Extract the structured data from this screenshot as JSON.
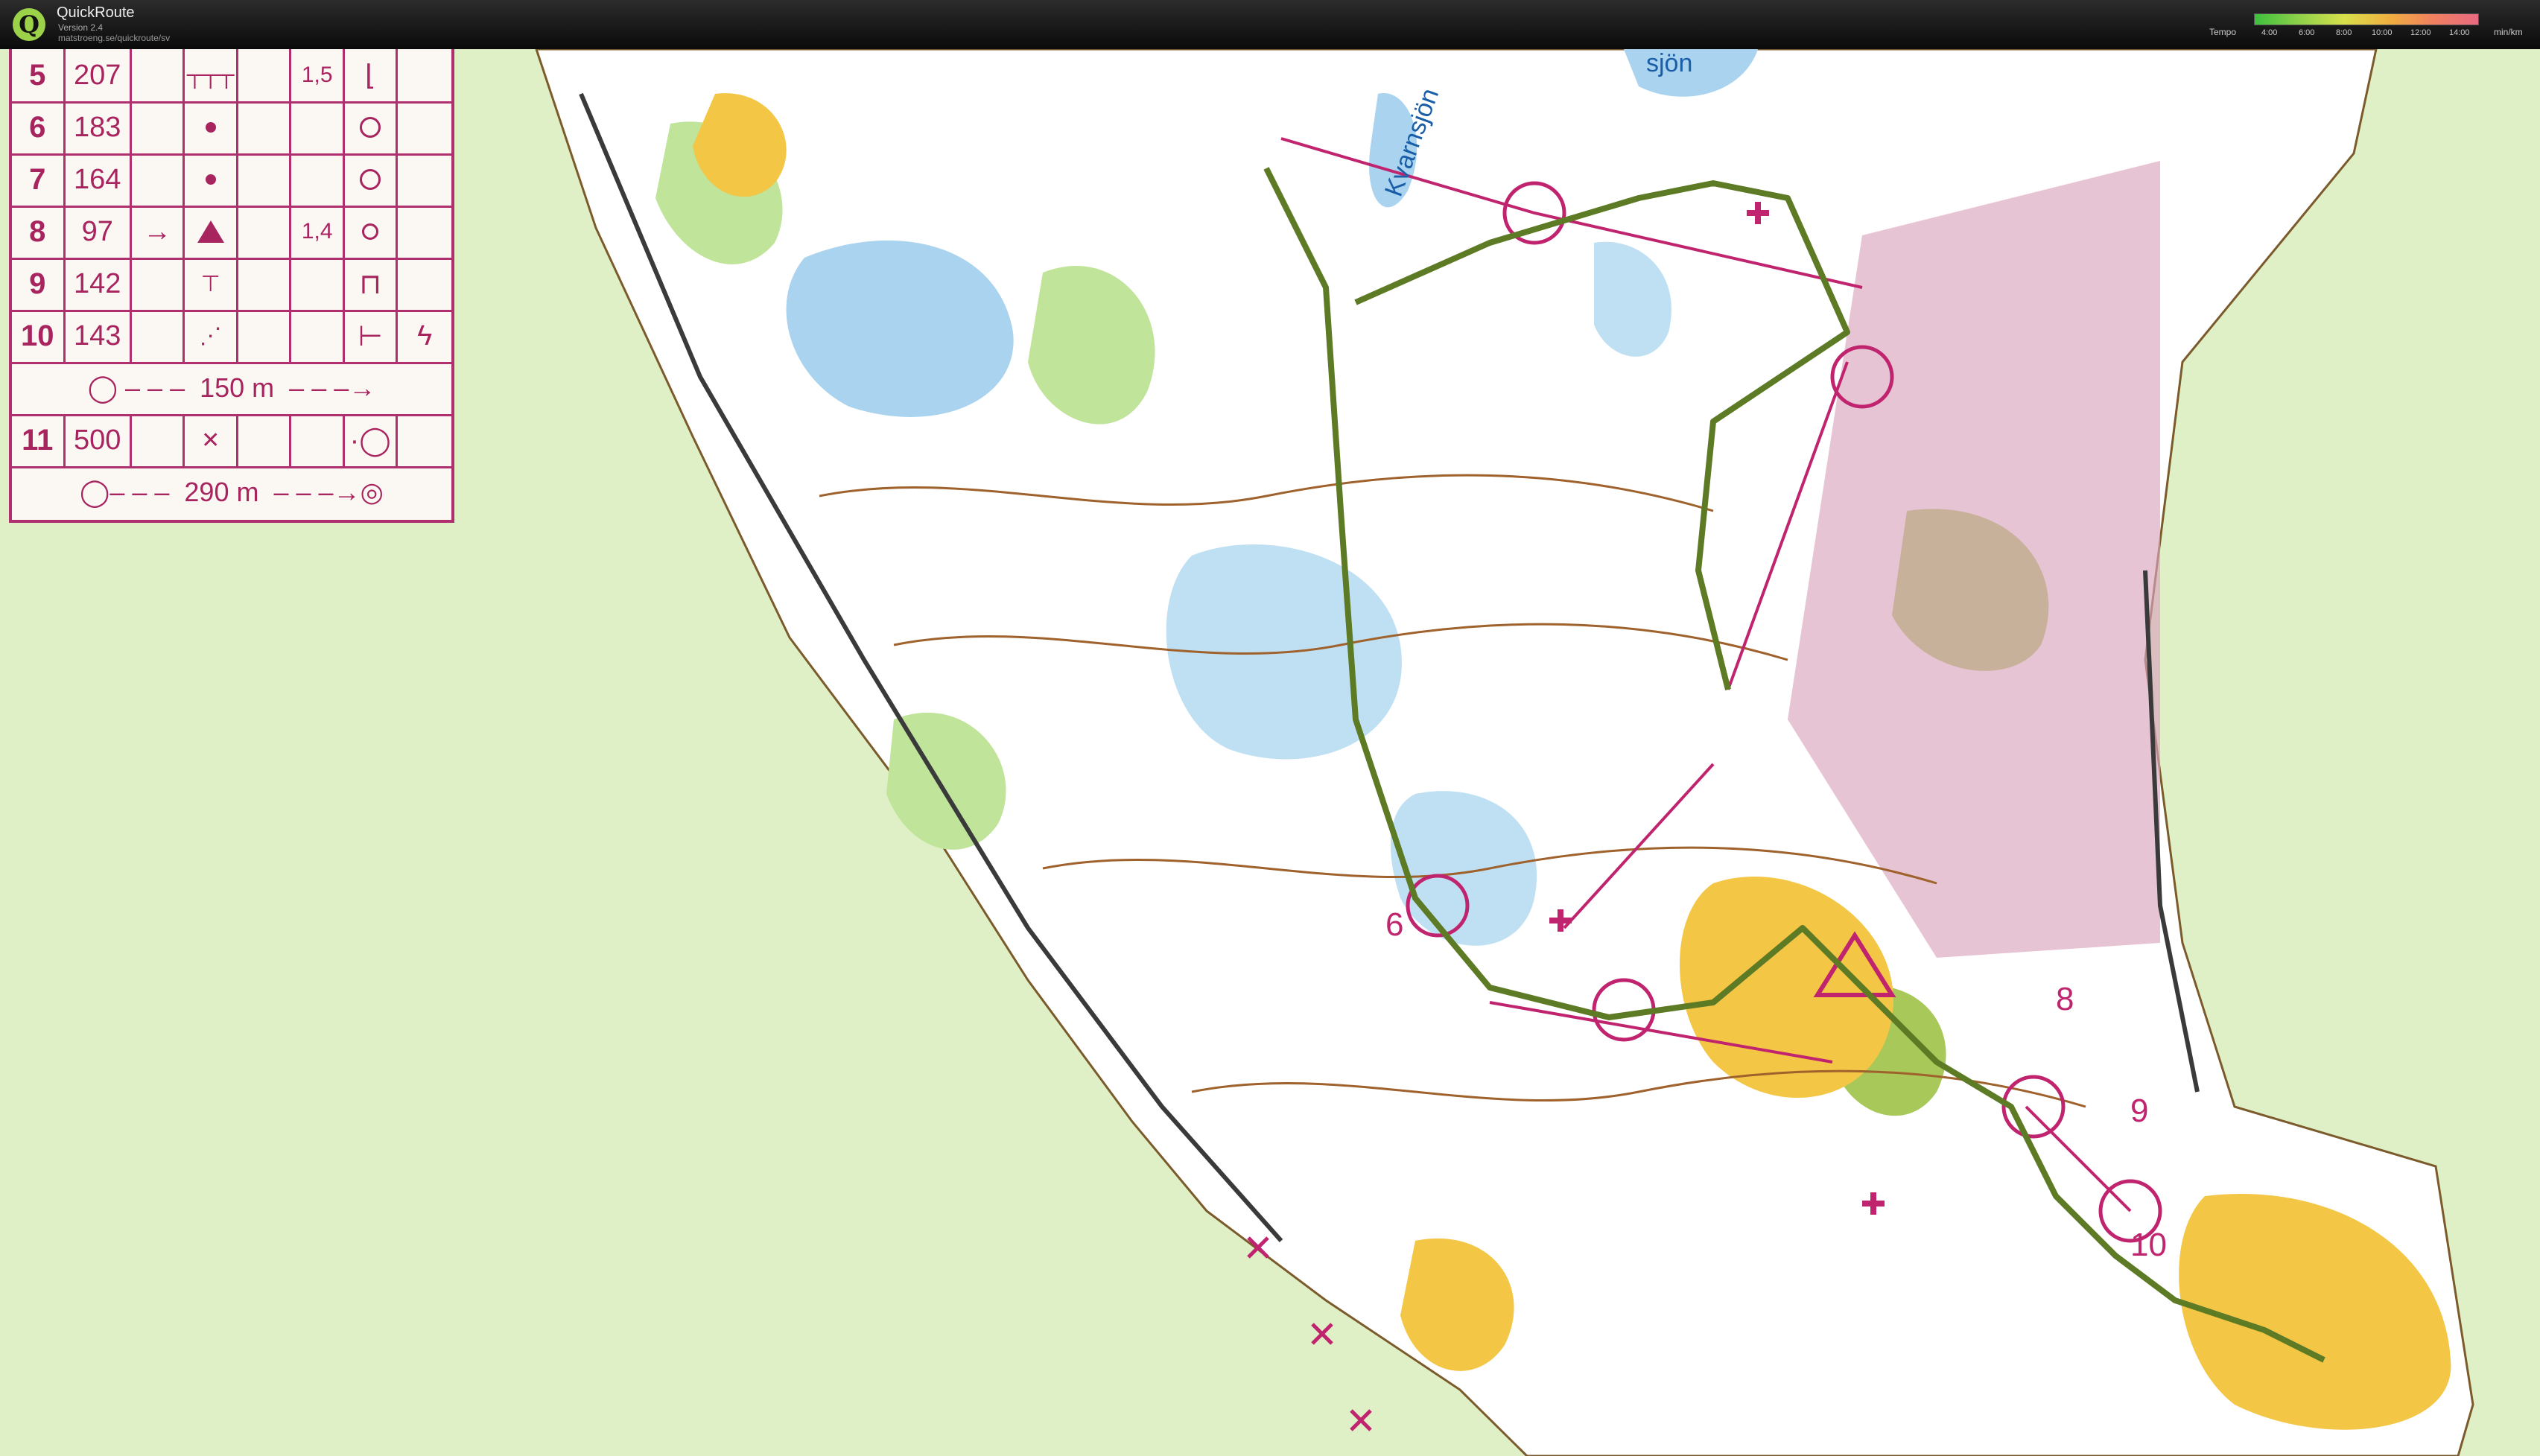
{
  "app": {
    "title": "QuickRoute",
    "version": "Version 2.4",
    "url": "matstroeng.se/quickroute/sv",
    "logo_letter": "Q"
  },
  "tempo": {
    "label": "Tempo",
    "unit": "min/km",
    "ticks": [
      "4:00",
      "6:00",
      "8:00",
      "10:00",
      "12:00",
      "14:00"
    ]
  },
  "map": {
    "labels": {
      "lake1": "Kvarnsjön",
      "lake2": "sjön"
    },
    "control_numbers": [
      "6",
      "8",
      "9",
      "10"
    ],
    "colors": {
      "route": "#5d7a24",
      "course": "#c0246e",
      "forest": "#ffffff",
      "open": "#f3c646",
      "water": "#a9d3ee",
      "green": "#9dca6a",
      "paper": "#dff0c6"
    }
  },
  "control_description": {
    "rows": [
      {
        "num": "5",
        "code": "207",
        "c": "",
        "d": "",
        "e": "1,5",
        "g": ""
      },
      {
        "num": "6",
        "code": "183",
        "c": "",
        "d": "",
        "e": "",
        "g": ""
      },
      {
        "num": "7",
        "code": "164",
        "c": "",
        "d": "",
        "e": "",
        "g": ""
      },
      {
        "num": "8",
        "code": "97",
        "c": "→",
        "d": "",
        "e": "1,4",
        "g": ""
      },
      {
        "num": "9",
        "code": "142",
        "c": "",
        "d": "",
        "e": "",
        "g": ""
      },
      {
        "num": "10",
        "code": "143",
        "c": "",
        "d": "",
        "e": "",
        "g": ""
      },
      {
        "num": "11",
        "code": "500",
        "c": "",
        "d": "✕",
        "e": "",
        "g": ""
      }
    ],
    "leg1": "150 m",
    "leg2": "290 m"
  }
}
